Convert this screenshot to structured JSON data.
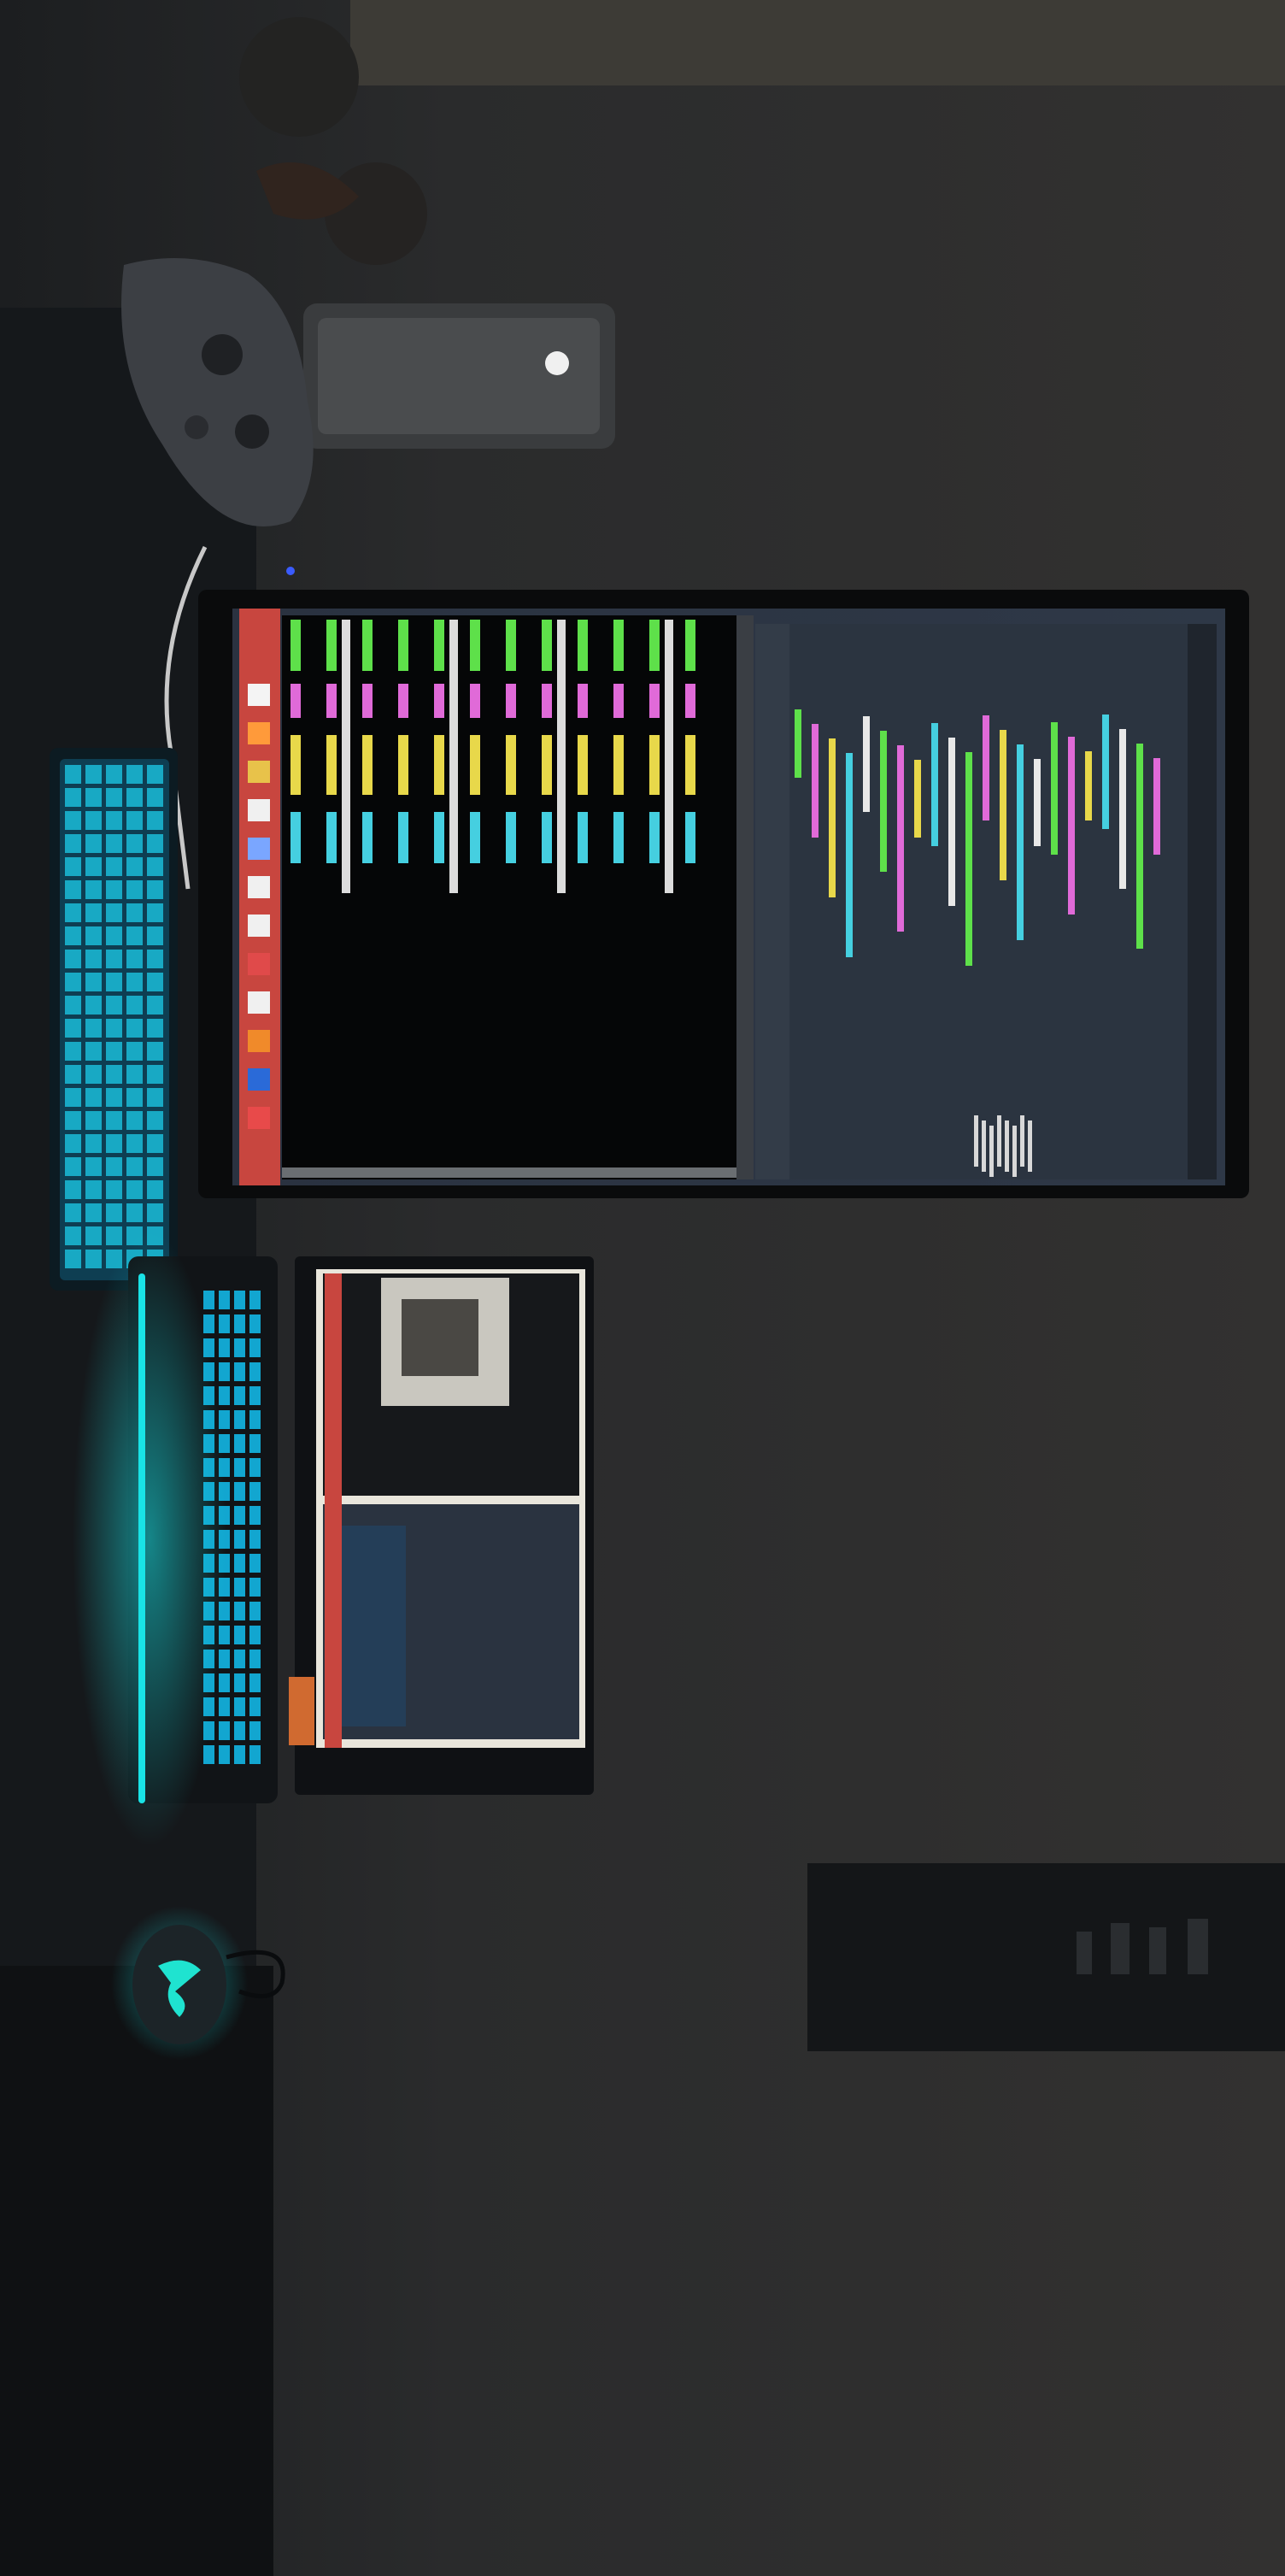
{
  "scene": {
    "description": "",
    "colors": {
      "wall": "#2b2c2d",
      "wall_light": "#3a3a38",
      "desk": "#15181b",
      "screen_bg": "#2a3240",
      "terminal_bg": "#050607",
      "ubuntu_red": "#c8463f",
      "neon_cyan": "#19e3e6",
      "code_green": "#5ee04a",
      "code_yellow": "#e8d84a",
      "code_pink": "#e06ad8",
      "code_cyan": "#45cfe0"
    },
    "icons": [
      "gamepad-icon",
      "mouse-icon",
      "dock-app-icons"
    ]
  }
}
